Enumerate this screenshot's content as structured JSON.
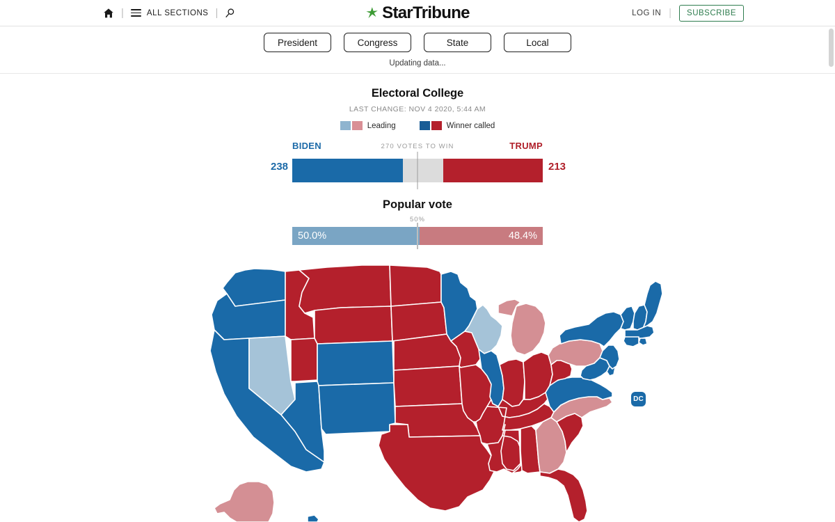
{
  "nav": {
    "home_icon": "home-icon",
    "menu_icon": "hamburger-icon",
    "all_sections": "ALL SECTIONS",
    "search_icon": "search-icon",
    "divider": "|",
    "brand": "StarTribune",
    "brand_icon": "star-icon",
    "log_in": "LOG IN",
    "subscribe": "SUBSCRIBE"
  },
  "tabs": [
    {
      "label": "President"
    },
    {
      "label": "Congress"
    },
    {
      "label": "State"
    },
    {
      "label": "Local"
    }
  ],
  "status": "Updating data...",
  "electoral": {
    "title": "Electoral College",
    "last_change": "LAST CHANGE: NOV 4 2020, 5:44 AM",
    "legend": [
      {
        "label": "Leading",
        "blue": "#8fb4cf",
        "red": "#d98f95"
      },
      {
        "label": "Winner called",
        "blue": "#1a5d96",
        "red": "#b4202c"
      }
    ],
    "left_name": "BIDEN",
    "right_name": "TRUMP",
    "midline_label": "270 VOTES TO WIN",
    "left_votes": "238",
    "right_votes": "213",
    "total_needed": 270,
    "total_votes": 538,
    "left_pct": 44.2,
    "right_pct": 39.6
  },
  "popular": {
    "title": "Popular vote",
    "midline_label": "50%",
    "left_value": "50.0%",
    "right_value": "48.4%",
    "left_pct": 50.0,
    "right_pct": 48.4
  },
  "map": {
    "dc_label": "DC",
    "colors": {
      "dem_called": "#1a6aa8",
      "dem_leading": "#a5c3d8",
      "gop_called": "#b4202c",
      "gop_leading": "#d48f94",
      "border": "#ffffff"
    },
    "states": [
      {
        "code": "WA",
        "status": "dem_called"
      },
      {
        "code": "OR",
        "status": "dem_called"
      },
      {
        "code": "CA",
        "status": "dem_called"
      },
      {
        "code": "NV",
        "status": "dem_leading"
      },
      {
        "code": "ID",
        "status": "gop_called"
      },
      {
        "code": "MT",
        "status": "gop_called"
      },
      {
        "code": "WY",
        "status": "gop_called"
      },
      {
        "code": "UT",
        "status": "gop_called"
      },
      {
        "code": "AZ",
        "status": "dem_called"
      },
      {
        "code": "CO",
        "status": "dem_called"
      },
      {
        "code": "NM",
        "status": "dem_called"
      },
      {
        "code": "ND",
        "status": "gop_called"
      },
      {
        "code": "SD",
        "status": "gop_called"
      },
      {
        "code": "NE",
        "status": "gop_called"
      },
      {
        "code": "KS",
        "status": "gop_called"
      },
      {
        "code": "OK",
        "status": "gop_called"
      },
      {
        "code": "TX",
        "status": "gop_called"
      },
      {
        "code": "MN",
        "status": "dem_called"
      },
      {
        "code": "IA",
        "status": "gop_called"
      },
      {
        "code": "MO",
        "status": "gop_called"
      },
      {
        "code": "AR",
        "status": "gop_called"
      },
      {
        "code": "LA",
        "status": "gop_called"
      },
      {
        "code": "WI",
        "status": "dem_leading"
      },
      {
        "code": "IL",
        "status": "dem_called"
      },
      {
        "code": "MI",
        "status": "gop_leading"
      },
      {
        "code": "IN",
        "status": "gop_called"
      },
      {
        "code": "OH",
        "status": "gop_called"
      },
      {
        "code": "KY",
        "status": "gop_called"
      },
      {
        "code": "TN",
        "status": "gop_called"
      },
      {
        "code": "MS",
        "status": "gop_called"
      },
      {
        "code": "AL",
        "status": "gop_called"
      },
      {
        "code": "GA",
        "status": "gop_leading"
      },
      {
        "code": "FL",
        "status": "gop_called"
      },
      {
        "code": "SC",
        "status": "gop_called"
      },
      {
        "code": "NC",
        "status": "gop_leading"
      },
      {
        "code": "VA",
        "status": "dem_called"
      },
      {
        "code": "WV",
        "status": "gop_called"
      },
      {
        "code": "PA",
        "status": "gop_leading"
      },
      {
        "code": "MD",
        "status": "dem_called"
      },
      {
        "code": "DE",
        "status": "dem_called"
      },
      {
        "code": "NJ",
        "status": "dem_called"
      },
      {
        "code": "NY",
        "status": "dem_called"
      },
      {
        "code": "CT",
        "status": "dem_called"
      },
      {
        "code": "RI",
        "status": "dem_called"
      },
      {
        "code": "MA",
        "status": "dem_called"
      },
      {
        "code": "VT",
        "status": "dem_called"
      },
      {
        "code": "NH",
        "status": "dem_called"
      },
      {
        "code": "ME",
        "status": "dem_called"
      },
      {
        "code": "AK",
        "status": "gop_leading"
      },
      {
        "code": "HI",
        "status": "dem_called"
      },
      {
        "code": "DC",
        "status": "dem_called"
      }
    ]
  }
}
